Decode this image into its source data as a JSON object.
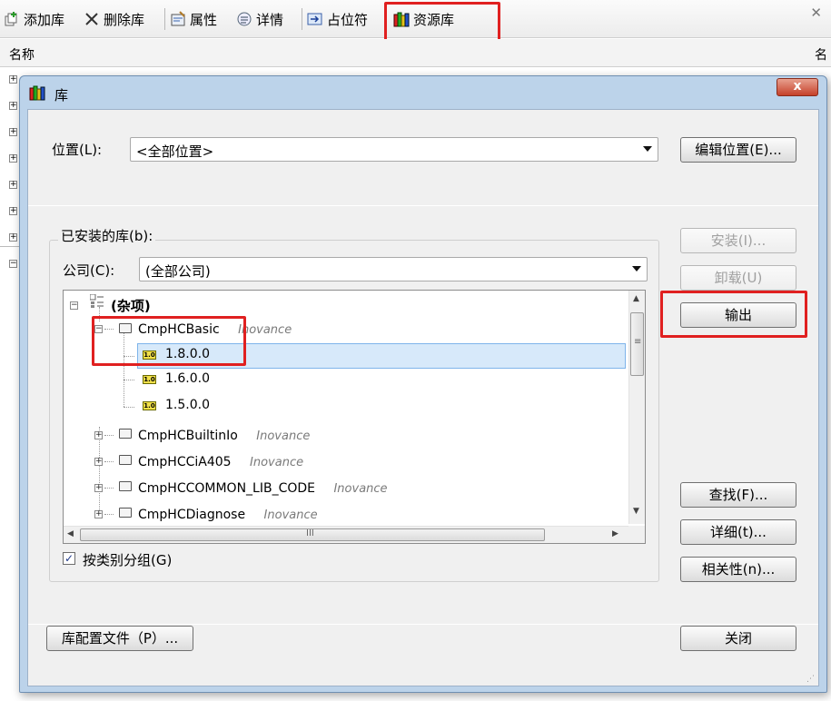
{
  "toolbar": {
    "add_lib": "添加库",
    "delete_lib": "删除库",
    "properties": "属性",
    "details": "详情",
    "placeholder": "占位符",
    "repository": "资源库"
  },
  "list": {
    "col_name": "名称",
    "col_name2": "名"
  },
  "dialog": {
    "title": "库",
    "close_glyph": "x",
    "location_label": "位置(L):",
    "location_value": "<全部位置>",
    "edit_location_btn": "编辑位置(E)...",
    "installed_label": "已安装的库(b):",
    "company_label": "公司(C):",
    "company_value": "(全部公司)",
    "install_btn": "安装(I)...",
    "uninstall_btn": "卸载(U)",
    "export_btn": "输出",
    "find_btn": "查找(F)...",
    "details_btn": "详细(t)...",
    "dependencies_btn": "相关性(n)...",
    "group_by_category": "按类别分组(G)",
    "group_checked": true,
    "profile_btn": "库配置文件（P）...",
    "close_btn": "关闭"
  },
  "tree": {
    "root": "(杂项)",
    "items": [
      {
        "name": "CmpHCBasic",
        "vendor": "Inovance",
        "expanded": true
      },
      {
        "name": "CmpHCBuiltinIo",
        "vendor": "Inovance"
      },
      {
        "name": "CmpHCCiA405",
        "vendor": "Inovance"
      },
      {
        "name": "CmpHCCOMMON_LIB_CODE",
        "vendor": "Inovance"
      },
      {
        "name": "CmpHCDiagnose",
        "vendor": "Inovance"
      }
    ],
    "versions": [
      "1.8.0.0",
      "1.6.0.0",
      "1.5.0.0"
    ],
    "selected_version": "1.8.0.0",
    "version_badge": "1.0",
    "hscroll_grip": "III",
    "vscroll_grip": "≡"
  },
  "colors": {
    "highlight": "#e02020",
    "selection": "#d7e9fa",
    "titlebar": "#bcd3ea"
  }
}
